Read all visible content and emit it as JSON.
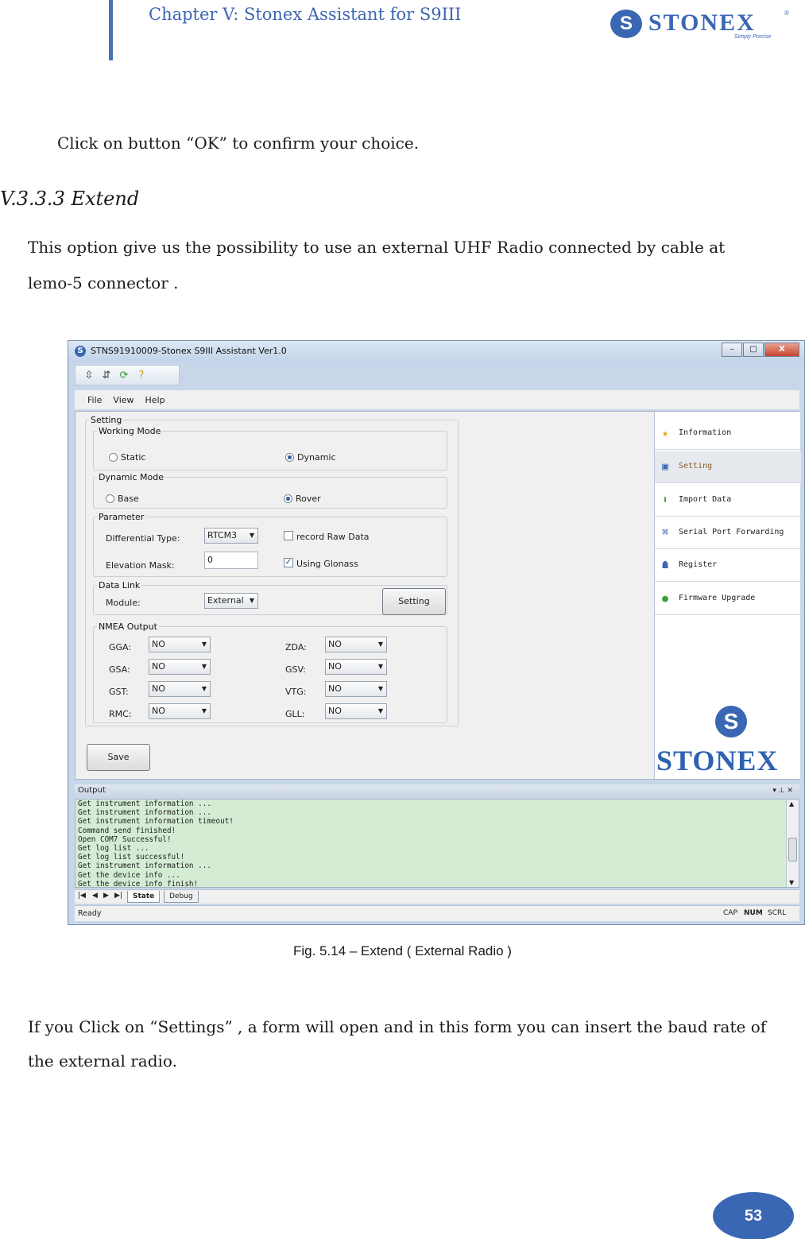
{
  "header": {
    "chapter_title": "Chapter V: Stonex Assistant for S9III",
    "logo_text": "STONEX",
    "logo_reg": "®",
    "logo_tagline": "Simply Precise"
  },
  "doc": {
    "para_ok": "Click on button “OK” to confirm your choice.",
    "heading": "V.3.3.3  Extend",
    "para_desc_1": "This option give us the possibility to  use an external UHF Radio connected by cable at",
    "para_desc_2": "lemo-5 connector .",
    "caption": "Fig. 5.14 – Extend ( External Radio )",
    "para_after_1": "If you Click on “Settings” , a form will open and in this form you can insert the baud rate of",
    "para_after_2": "the external radio.",
    "page_number": "53"
  },
  "app": {
    "window_title": "STNS91910009-Stonex S9III Assistant Ver1.0",
    "window_buttons": {
      "minimize": "–",
      "maximize": "□",
      "close": "X"
    },
    "menu": [
      "File",
      "View",
      "Help"
    ],
    "setting": {
      "title": "Setting",
      "working_mode": {
        "title": "Working Mode",
        "options": [
          "Static",
          "Dynamic"
        ],
        "selected": "Dynamic"
      },
      "dynamic_mode": {
        "title": "Dynamic Mode",
        "options": [
          "Base",
          "Rover"
        ],
        "selected": "Rover"
      },
      "parameter": {
        "title": "Parameter",
        "differential_type_label": "Differential Type:",
        "differential_type_value": "RTCM3",
        "elevation_mask_label": "Elevation Mask:",
        "elevation_mask_value": "0",
        "record_raw_label": "record Raw Data",
        "record_raw_checked": false,
        "glonass_label": "Using Glonass",
        "glonass_checked": true
      },
      "data_link": {
        "title": "Data Link",
        "module_label": "Module:",
        "module_value": "External",
        "setting_button": "Setting"
      },
      "nmea": {
        "title": "NMEA Output",
        "left": [
          {
            "label": "GGA:",
            "value": "NO"
          },
          {
            "label": "GSA:",
            "value": "NO"
          },
          {
            "label": "GST:",
            "value": "NO"
          },
          {
            "label": "RMC:",
            "value": "NO"
          }
        ],
        "right": [
          {
            "label": "ZDA:",
            "value": "NO"
          },
          {
            "label": "GSV:",
            "value": "NO"
          },
          {
            "label": "VTG:",
            "value": "NO"
          },
          {
            "label": "GLL:",
            "value": "NO"
          }
        ]
      },
      "save_button": "Save"
    },
    "side_menu": [
      "Information",
      "Setting",
      "Import Data",
      "Serial Port Forwarding",
      "Register",
      "Firmware Upgrade"
    ],
    "side_logo": "STONEX",
    "output": {
      "title": "Output",
      "controls": "▾  ⊥  ✕",
      "lines": [
        "Get instrument information ...",
        "Get instrument information ...",
        "Get instrument information timeout!",
        "Command send finished!",
        "Open COM7 Successful!",
        "Get log list ...",
        "Get log list successful!",
        "Get instrument information ...",
        "Get the device info ...",
        "Get the device info finish!"
      ]
    },
    "tabs": [
      "State",
      "Debug"
    ],
    "status": {
      "ready": "Ready",
      "indicators": [
        "CAP",
        "NUM",
        "SCRL"
      ]
    }
  }
}
